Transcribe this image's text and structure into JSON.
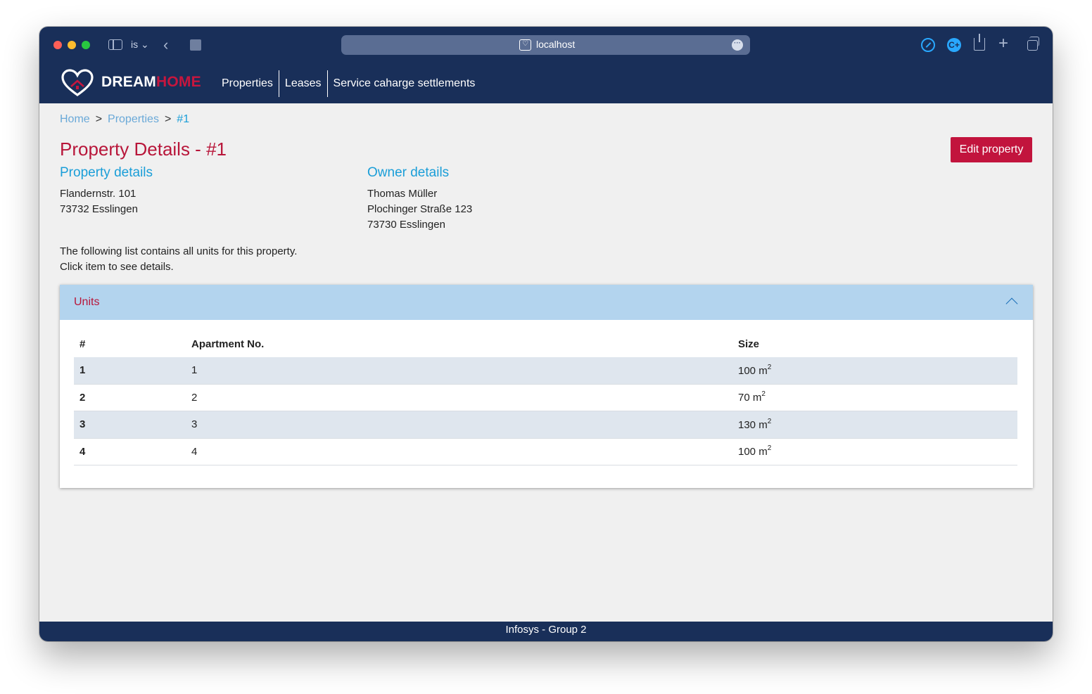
{
  "browser": {
    "profile_label": "is ⌄",
    "url": "localhost",
    "extension_2_label": "C+"
  },
  "brand": {
    "logo_part1": "DREAM",
    "logo_part2": "HOME"
  },
  "nav": {
    "items": [
      {
        "label": "Properties"
      },
      {
        "label": "Leases"
      },
      {
        "label": "Service caharge settlements"
      }
    ]
  },
  "breadcrumb": {
    "home": "Home",
    "properties": "Properties",
    "current": "#1",
    "separator": ">"
  },
  "page": {
    "title": "Property Details - #1",
    "edit_button": "Edit property"
  },
  "property": {
    "heading": "Property details",
    "street": "Flandernstr. 101",
    "city": "73732 Esslingen"
  },
  "owner": {
    "heading": "Owner details",
    "name": "Thomas Müller",
    "street": "Plochinger Straße 123",
    "city": "73730 Esslingen"
  },
  "intro": {
    "line1": "The following list contains all units for this property.",
    "line2": "Click item to see details."
  },
  "units": {
    "title": "Units",
    "columns": [
      "#",
      "Apartment No.",
      "Size"
    ],
    "size_unit": "m",
    "size_exponent": "2",
    "rows": [
      {
        "id": "1",
        "apartment": "1",
        "size": "100"
      },
      {
        "id": "2",
        "apartment": "2",
        "size": "70"
      },
      {
        "id": "3",
        "apartment": "3",
        "size": "130"
      },
      {
        "id": "4",
        "apartment": "4",
        "size": "100"
      }
    ]
  },
  "footer": {
    "text": "Infosys - Group 2"
  },
  "colors": {
    "nav_bg": "#192f59",
    "brand_red": "#c2143d",
    "accent_blue": "#1a9ed8",
    "card_header": "#b3d4ee"
  }
}
